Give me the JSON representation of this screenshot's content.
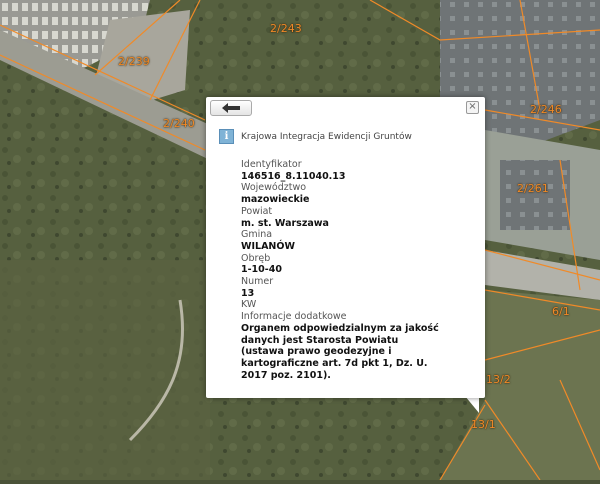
{
  "map": {
    "parcel_labels": [
      "2/243",
      "2/239",
      "2/240",
      "2/246",
      "2/261",
      "6/1",
      "13/2",
      "13/1"
    ]
  },
  "popup": {
    "service_title": "Krajowa Integracja Ewidencji Gruntów",
    "close_symbol": "×",
    "back_symbol": "◀",
    "attributes": [
      {
        "label": "Identyfikator",
        "value": "146516_8.11040.13"
      },
      {
        "label": "Województwo",
        "value": "mazowieckie"
      },
      {
        "label": "Powiat",
        "value": "m. st. Warszawa"
      },
      {
        "label": "Gmina",
        "value": "WILANÓW"
      },
      {
        "label": "Obręb",
        "value": "1-10-40"
      },
      {
        "label": "Numer",
        "value": "13"
      },
      {
        "label": "KW",
        "value": ""
      },
      {
        "label": "Informacje dodatkowe",
        "value": "Organem odpowiedzialnym za jakość danych jest Starosta Powiatu (ustawa prawo geodezyjne i kartograficzne art. 7d pkt 1, Dz. U. 2017 poz. 2101)."
      }
    ]
  },
  "colors": {
    "parcel_outline": "#f08a28",
    "popup_background": "#ffffff",
    "info_icon": "#7fb3d6"
  }
}
